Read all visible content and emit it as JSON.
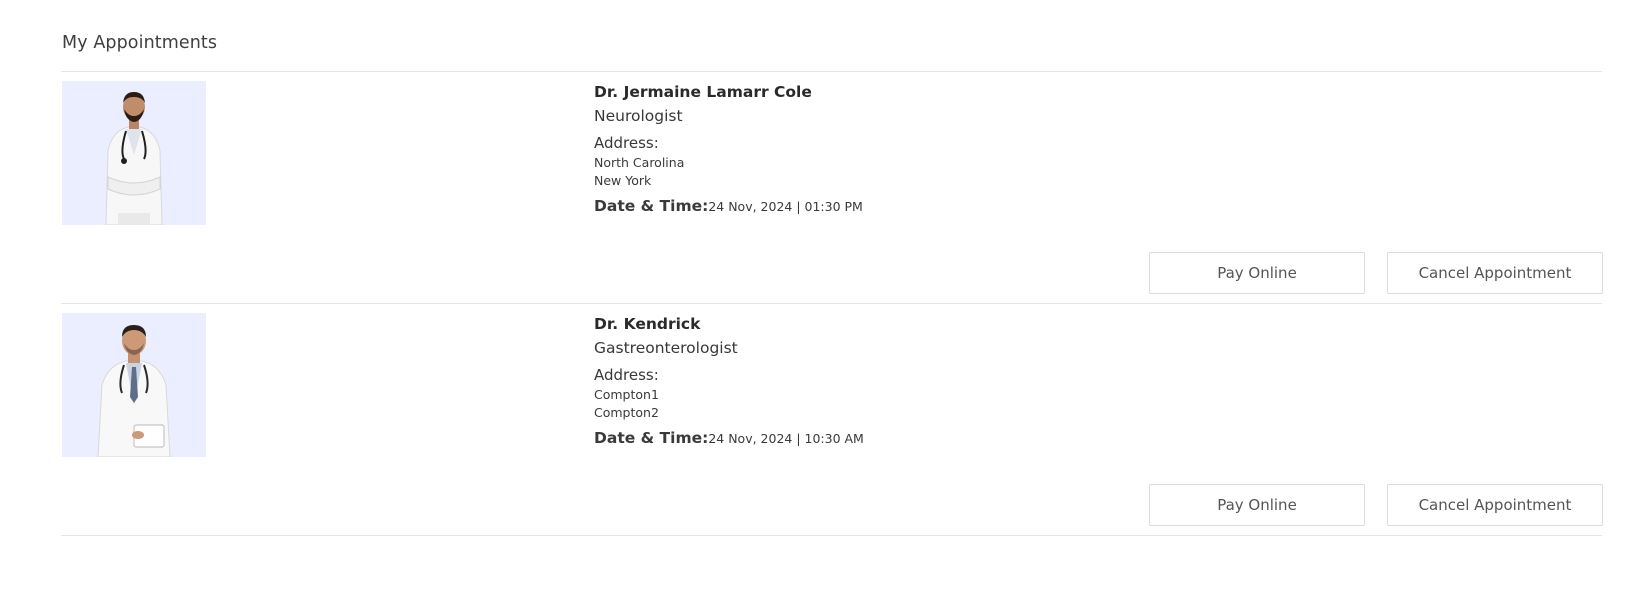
{
  "page": {
    "title": "My Appointments"
  },
  "appointments": [
    {
      "doctor_name": "Dr. Jermaine Lamarr Cole",
      "speciality": "Neurologist",
      "address_label": "Address:",
      "address_line1": "North Carolina",
      "address_line2": "New York",
      "datetime_label": "Date & Time:",
      "datetime_value": "24 Nov, 2024 | 01:30 PM",
      "pay_label": "Pay Online",
      "cancel_label": "Cancel Appointment"
    },
    {
      "doctor_name": "Dr. Kendrick",
      "speciality": "Gastreonterologist",
      "address_label": "Address:",
      "address_line1": "Compton1",
      "address_line2": "Compton2",
      "datetime_label": "Date & Time:",
      "datetime_value": "24 Nov, 2024 | 10:30 AM",
      "pay_label": "Pay Online",
      "cancel_label": "Cancel Appointment"
    }
  ],
  "colors": {
    "photo_background": "#eaeefe",
    "divider": "#e4e4e4",
    "button_border": "#dcdcdc"
  }
}
